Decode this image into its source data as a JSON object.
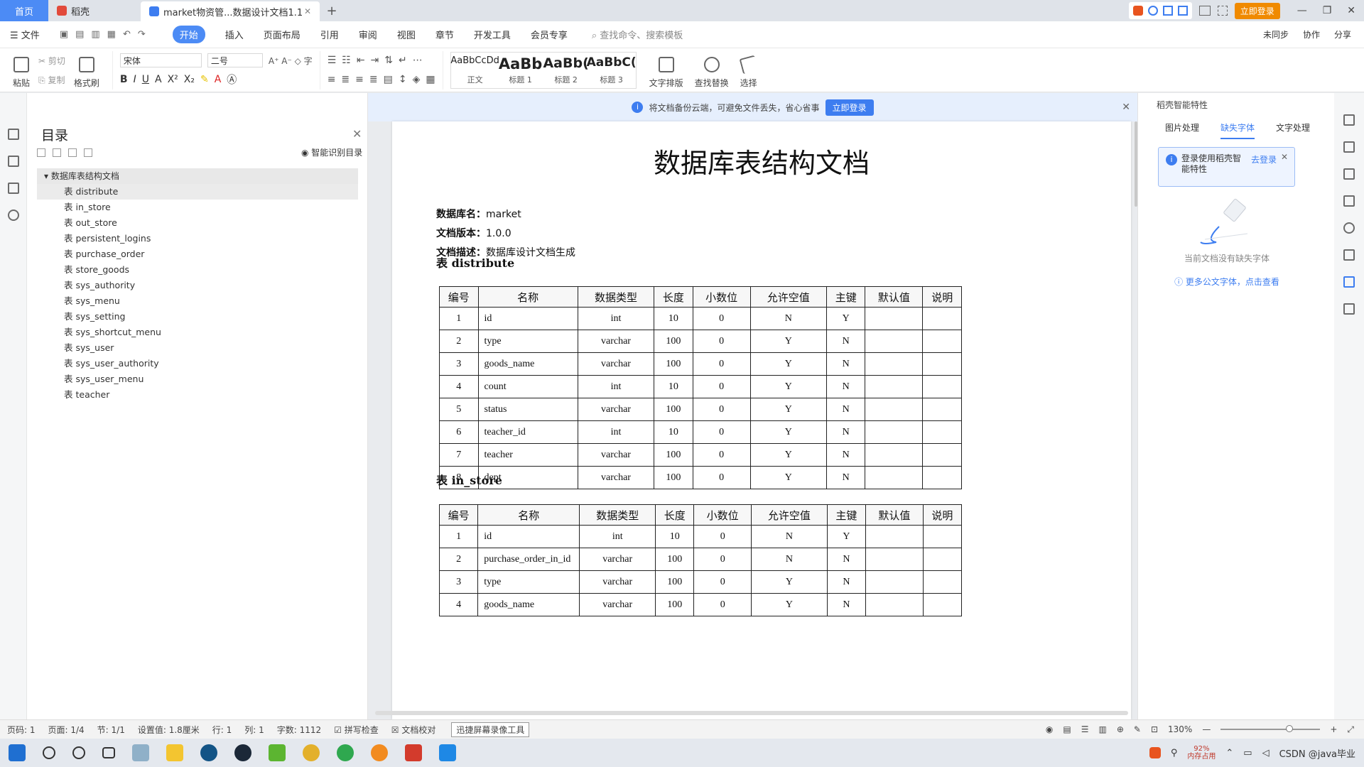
{
  "titlebar": {
    "home_tab": "首页",
    "daoke_tab": "稻壳",
    "doc_tab": "market物资管...数据设计文档1.1",
    "login_button": "立即登录"
  },
  "menu": {
    "file": "文件",
    "items": [
      "开始",
      "插入",
      "页面布局",
      "引用",
      "审阅",
      "视图",
      "章节",
      "开发工具",
      "会员专享"
    ],
    "search_placeholder": "查找命令、搜索模板",
    "right": [
      "未同步",
      "协作",
      "分享"
    ]
  },
  "ribbon": {
    "paste": "粘贴",
    "cut": "剪切",
    "copy": "复制",
    "format_painter": "格式刷",
    "font_name": "宋体",
    "font_size": "二号",
    "styles": [
      {
        "sample": "AaBbCcDd",
        "label": "正文"
      },
      {
        "sample": "AaBb",
        "label": "标题 1"
      },
      {
        "sample": "AaBb(",
        "label": "标题 2"
      },
      {
        "sample": "AaBbC(",
        "label": "标题 3"
      }
    ],
    "text_layout": "文字排版",
    "find_replace": "查找替换",
    "select": "选择"
  },
  "toc": {
    "title": "目录",
    "ai_toc": "智能识别目录",
    "root": "数据库表结构文档",
    "items": [
      "表 distribute",
      "表 in_store",
      "表 out_store",
      "表 persistent_logins",
      "表 purchase_order",
      "表 store_goods",
      "表 sys_authority",
      "表 sys_menu",
      "表 sys_setting",
      "表 sys_shortcut_menu",
      "表 sys_user",
      "表 sys_user_authority",
      "表 sys_user_menu",
      "表 teacher"
    ]
  },
  "infobar": {
    "text": "将文档备份云端，可避免文件丢失，省心省事",
    "button": "立即登录"
  },
  "document": {
    "title": "数据库表结构文档",
    "db_label": "数据库名：",
    "db_value": "market",
    "version_label": "文档版本：",
    "version_value": "1.0.0",
    "desc_label": "文档描述：",
    "desc_value": "数据库设计文档生成",
    "columns": [
      "编号",
      "名称",
      "数据类型",
      "长度",
      "小数位",
      "允许空值",
      "主键",
      "默认值",
      "说明"
    ],
    "tables": [
      {
        "heading": "表 distribute",
        "rows": [
          [
            "1",
            "id",
            "int",
            "10",
            "0",
            "N",
            "Y",
            "",
            ""
          ],
          [
            "2",
            "type",
            "varchar",
            "100",
            "0",
            "Y",
            "N",
            "",
            ""
          ],
          [
            "3",
            "goods_name",
            "varchar",
            "100",
            "0",
            "Y",
            "N",
            "",
            ""
          ],
          [
            "4",
            "count",
            "int",
            "10",
            "0",
            "Y",
            "N",
            "",
            ""
          ],
          [
            "5",
            "status",
            "varchar",
            "100",
            "0",
            "Y",
            "N",
            "",
            ""
          ],
          [
            "6",
            "teacher_id",
            "int",
            "10",
            "0",
            "Y",
            "N",
            "",
            ""
          ],
          [
            "7",
            "teacher",
            "varchar",
            "100",
            "0",
            "Y",
            "N",
            "",
            ""
          ],
          [
            "8",
            "dept",
            "varchar",
            "100",
            "0",
            "Y",
            "N",
            "",
            ""
          ]
        ]
      },
      {
        "heading": "表 in_store",
        "rows": [
          [
            "1",
            "id",
            "int",
            "10",
            "0",
            "N",
            "Y",
            "",
            ""
          ],
          [
            "2",
            "purchase_order_in_id",
            "varchar",
            "100",
            "0",
            "N",
            "N",
            "",
            ""
          ],
          [
            "3",
            "type",
            "varchar",
            "100",
            "0",
            "Y",
            "N",
            "",
            ""
          ],
          [
            "4",
            "goods_name",
            "varchar",
            "100",
            "0",
            "Y",
            "N",
            "",
            ""
          ]
        ]
      }
    ]
  },
  "right_panel": {
    "title": "稻壳智能特性",
    "tabs": [
      "图片处理",
      "缺失字体",
      "文字处理"
    ],
    "active_tab": "缺失字体",
    "notice": "登录使用稻壳智能特性",
    "notice_link": "去登录",
    "empty_text": "当前文档没有缺失字体",
    "more_link": "更多公文字体，点击查看"
  },
  "statusbar": {
    "page": "页码: 1",
    "pages": "页面: 1/4",
    "section": "节: 1/1",
    "setting": "设置值: 1.8厘米",
    "row": "行: 1",
    "col": "列: 1",
    "words": "字数: 1112",
    "spell": "拼写检查",
    "proof": "文档校对",
    "tooltip": "迅捷屏幕录像工具",
    "zoom": "130%"
  },
  "taskbar": {
    "memory_pct": "92%",
    "memory_label": "内存占用",
    "watermark_text": "CSDN @java毕业"
  },
  "colors": {
    "accent": "#4c8bf5",
    "login_orange": "#f08a00",
    "link_blue": "#3d7df0"
  }
}
